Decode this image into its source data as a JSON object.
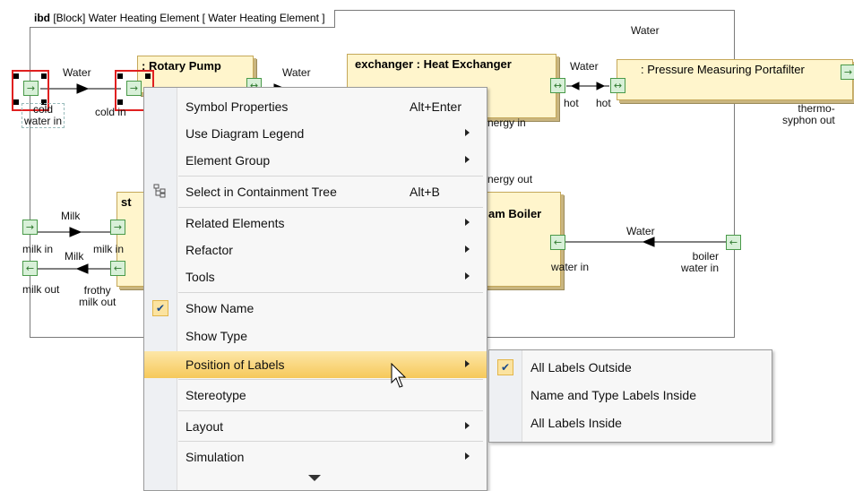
{
  "diagram": {
    "frame_kind": "ibd",
    "frame_rest": "[Block] Water Heating Element [ Water Heating Element ]",
    "top_label": "Water",
    "blocks": {
      "rotary_pump": ": Rotary Pump",
      "heat_exchanger": "exchanger : Heat Exchanger",
      "pressure_portafilter": ": Pressure Measuring Portafilter",
      "steam_left": "st",
      "steam_boiler": "am Boiler"
    },
    "connector_labels": {
      "water1": "Water",
      "water2": "Water",
      "water3": "Water",
      "water4": "Water",
      "milk1": "Milk",
      "milk2": "Milk"
    },
    "port_labels": {
      "cold_water_in": "cold\nwater in",
      "cold_in": "cold in",
      "hot1": "hot",
      "hot2": "hot",
      "thermo_out": "thermo-\nsyphon out",
      "energy_in": "nergy in",
      "energy_out": "nergy out",
      "milk_in": "milk in",
      "milk_in2": "milk in",
      "milk_out": "milk out",
      "frothy_milk_out": "frothy\nmilk out",
      "water_in": "water in",
      "boiler_water_in": "boiler\nwater in"
    }
  },
  "context_menu": {
    "items": [
      {
        "label": "Symbol Properties",
        "shortcut": "Alt+Enter"
      },
      {
        "label": "Use Diagram Legend"
      },
      {
        "label": "Element Group"
      },
      {
        "label": "Select in Containment Tree",
        "shortcut": "Alt+B"
      },
      {
        "label": "Related Elements"
      },
      {
        "label": "Refactor"
      },
      {
        "label": "Tools"
      },
      {
        "label": "Show Name"
      },
      {
        "label": "Show Type"
      },
      {
        "label": "Position of Labels"
      },
      {
        "label": "Stereotype"
      },
      {
        "label": "Layout"
      },
      {
        "label": "Simulation"
      }
    ],
    "checked": [
      "Show Name"
    ],
    "highlighted": "Position of Labels"
  },
  "submenu": {
    "items": [
      {
        "label": "All Labels Outside"
      },
      {
        "label": "Name and Type Labels Inside"
      },
      {
        "label": "All Labels Inside"
      }
    ],
    "checked": "All Labels Outside"
  },
  "colors": {
    "highlight": "#f6c95a",
    "block_fill": "#fff5cc",
    "port_fill": "#d8f0d8",
    "selection": "#e02020"
  }
}
